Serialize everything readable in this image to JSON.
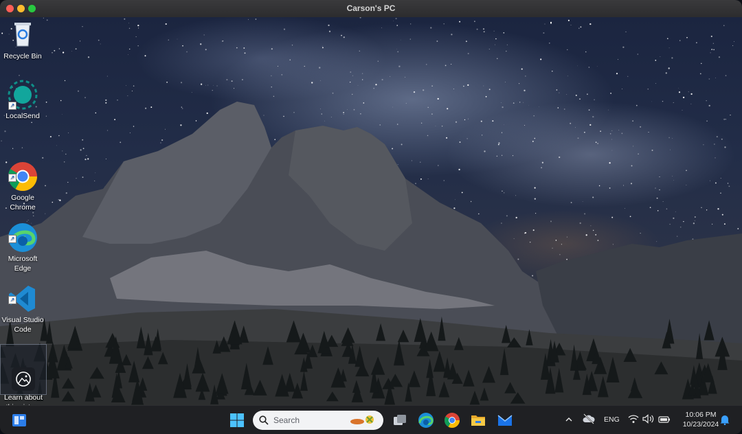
{
  "window": {
    "title": "Carson's PC"
  },
  "desktop": {
    "icons": [
      {
        "label": "Recycle Bin",
        "icon": "recycle-bin-icon"
      },
      {
        "label": "LocalSend",
        "icon": "localsend-icon"
      },
      {
        "label": "Google\nChrome",
        "icon": "chrome-icon"
      },
      {
        "label": "Microsoft\nEdge",
        "icon": "edge-icon"
      },
      {
        "label": "Visual Studio\nCode",
        "icon": "vscode-icon"
      },
      {
        "label": "Learn about\nthis picture",
        "icon": "camera-icon"
      }
    ]
  },
  "taskbar": {
    "search_placeholder": "Search",
    "pinned": [
      "start-icon",
      "task-view-icon",
      "edge-icon",
      "chrome-icon",
      "file-explorer-icon",
      "mail-icon"
    ],
    "tray": {
      "language": "ENG",
      "time": "10:06 PM",
      "date": "10/23/2024"
    }
  }
}
